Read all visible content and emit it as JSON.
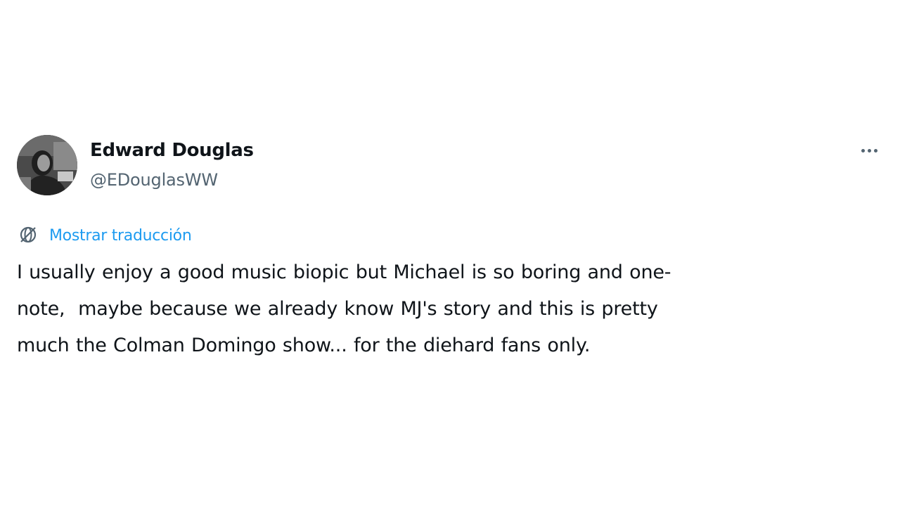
{
  "tweet": {
    "author": {
      "display_name": "Edward Douglas",
      "handle": "@EDouglasWW",
      "avatar_icon": "profile-photo"
    },
    "more_icon": "more-options-icon",
    "translate": {
      "icon": "translate-globe-icon",
      "label": "Mostrar traducción",
      "color": "#1d9bf0"
    },
    "text_lines": [
      "I usually enjoy a good music biopic but Michael is so boring and one-",
      "note,  maybe because we already know MJ's story and this is pretty",
      "much the Colman Domingo show... for the diehard fans only."
    ]
  },
  "colors": {
    "text": "#0f1419",
    "secondary": "#536471",
    "link": "#1d9bf0",
    "background": "#ffffff"
  }
}
